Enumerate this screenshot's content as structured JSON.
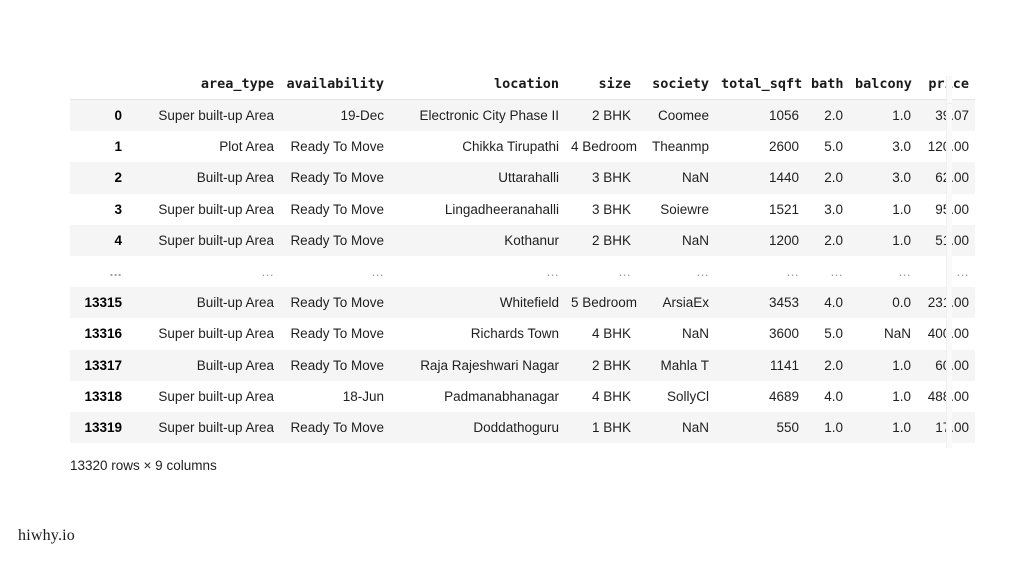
{
  "document": {
    "type": "pandas-dataframe-output",
    "shape_caption": "13320 rows × 9 columns",
    "watermark": "hiwhy.io"
  },
  "table": {
    "index_header": "",
    "columns": [
      {
        "key": "area_type",
        "label": "area_type"
      },
      {
        "key": "availability",
        "label": "availability"
      },
      {
        "key": "location",
        "label": "location"
      },
      {
        "key": "size",
        "label": "size"
      },
      {
        "key": "society",
        "label": "society"
      },
      {
        "key": "total_sqft",
        "label": "total_sqft"
      },
      {
        "key": "bath",
        "label": "bath"
      },
      {
        "key": "balcony",
        "label": "balcony"
      },
      {
        "key": "price",
        "label": "price"
      }
    ],
    "ellipsis": "...",
    "rows": [
      {
        "index": "0",
        "area_type": "Super built-up Area",
        "availability": "19-Dec",
        "location": "Electronic City Phase II",
        "size": "2 BHK",
        "society": "Coomee",
        "total_sqft": "1056",
        "bath": "2.0",
        "balcony": "1.0",
        "price": "39.07"
      },
      {
        "index": "1",
        "area_type": "Plot Area",
        "availability": "Ready To Move",
        "location": "Chikka Tirupathi",
        "size": "4 Bedroom",
        "society": "Theanmp",
        "total_sqft": "2600",
        "bath": "5.0",
        "balcony": "3.0",
        "price": "120.00"
      },
      {
        "index": "2",
        "area_type": "Built-up Area",
        "availability": "Ready To Move",
        "location": "Uttarahalli",
        "size": "3 BHK",
        "society": "NaN",
        "total_sqft": "1440",
        "bath": "2.0",
        "balcony": "3.0",
        "price": "62.00"
      },
      {
        "index": "3",
        "area_type": "Super built-up Area",
        "availability": "Ready To Move",
        "location": "Lingadheeranahalli",
        "size": "3 BHK",
        "society": "Soiewre",
        "total_sqft": "1521",
        "bath": "3.0",
        "balcony": "1.0",
        "price": "95.00"
      },
      {
        "index": "4",
        "area_type": "Super built-up Area",
        "availability": "Ready To Move",
        "location": "Kothanur",
        "size": "2 BHK",
        "society": "NaN",
        "total_sqft": "1200",
        "bath": "2.0",
        "balcony": "1.0",
        "price": "51.00"
      },
      {
        "index": "...",
        "area_type": "...",
        "availability": "...",
        "location": "...",
        "size": "...",
        "society": "...",
        "total_sqft": "...",
        "bath": "...",
        "balcony": "...",
        "price": "...",
        "is_ellipsis": true
      },
      {
        "index": "13315",
        "area_type": "Built-up Area",
        "availability": "Ready To Move",
        "location": "Whitefield",
        "size": "5 Bedroom",
        "society": "ArsiaEx",
        "total_sqft": "3453",
        "bath": "4.0",
        "balcony": "0.0",
        "price": "231.00"
      },
      {
        "index": "13316",
        "area_type": "Super built-up Area",
        "availability": "Ready To Move",
        "location": "Richards Town",
        "size": "4 BHK",
        "society": "NaN",
        "total_sqft": "3600",
        "bath": "5.0",
        "balcony": "NaN",
        "price": "400.00"
      },
      {
        "index": "13317",
        "area_type": "Built-up Area",
        "availability": "Ready To Move",
        "location": "Raja Rajeshwari Nagar",
        "size": "2 BHK",
        "society": "Mahla T",
        "total_sqft": "1141",
        "bath": "2.0",
        "balcony": "1.0",
        "price": "60.00"
      },
      {
        "index": "13318",
        "area_type": "Super built-up Area",
        "availability": "18-Jun",
        "location": "Padmanabhanagar",
        "size": "4 BHK",
        "society": "SollyCl",
        "total_sqft": "4689",
        "bath": "4.0",
        "balcony": "1.0",
        "price": "488.00"
      },
      {
        "index": "13319",
        "area_type": "Super built-up Area",
        "availability": "Ready To Move",
        "location": "Doddathoguru",
        "size": "1 BHK",
        "society": "NaN",
        "total_sqft": "550",
        "bath": "1.0",
        "balcony": "1.0",
        "price": "17.00"
      }
    ]
  },
  "colors": {
    "page_background": "#ffffff",
    "row_stripe": "#f5f5f5",
    "text": "#1f1f1f",
    "header_text": "#1a1a1a",
    "rule": "#e3e3e3",
    "ellipsis_text": "#9a9a9a"
  }
}
